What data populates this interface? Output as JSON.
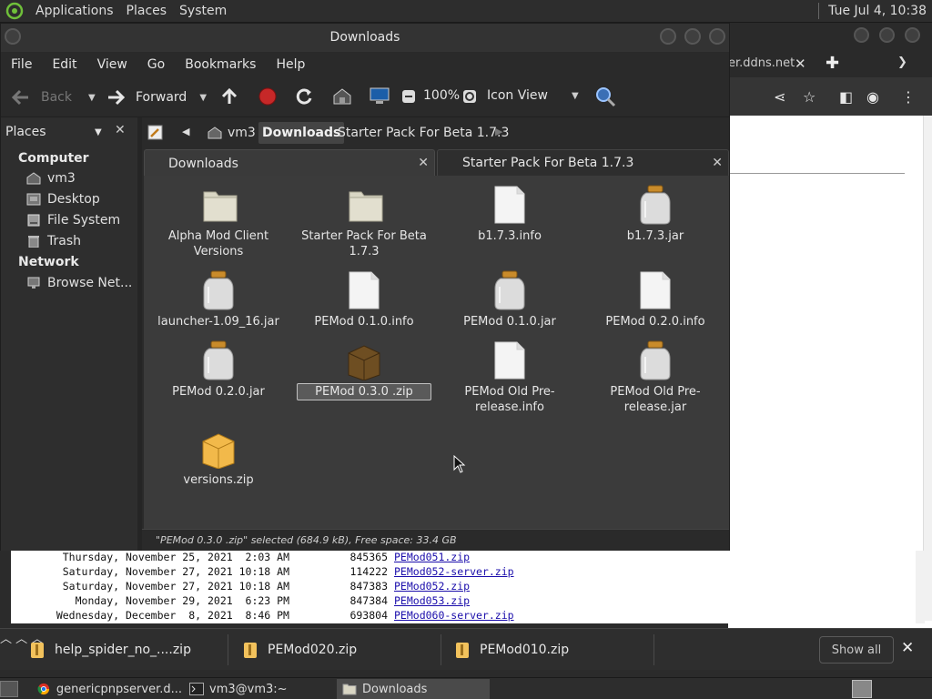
{
  "top_panel": {
    "menus": [
      "Applications",
      "Places",
      "System"
    ],
    "clock": "Tue Jul  4, 10:38"
  },
  "browser": {
    "tab_fragment": "er.ddns.net",
    "listing": [
      {
        "date": "Thursday, November 25, 2021  2:03 AM",
        "size": "845365",
        "name": "PEMod051.zip"
      },
      {
        "date": "Saturday, November 27, 2021 10:18 AM",
        "size": "114222",
        "name": "PEMod052-server.zip"
      },
      {
        "date": "Saturday, November 27, 2021 10:18 AM",
        "size": "847383",
        "name": "PEMod052.zip"
      },
      {
        "date": "Monday, November 29, 2021  6:23 PM",
        "size": "847384",
        "name": "PEMod053.zip"
      },
      {
        "date": "Wednesday, December  8, 2021  8:46 PM",
        "size": "693804",
        "name": "PEMod060-server.zip"
      }
    ],
    "downloads": [
      "help_spider_no_....zip",
      "PEMod020.zip",
      "PEMod010.zip"
    ],
    "show_all": "Show all"
  },
  "window": {
    "title": "Downloads",
    "menu": [
      "File",
      "Edit",
      "View",
      "Go",
      "Bookmarks",
      "Help"
    ],
    "toolbar": {
      "back": "Back",
      "forward": "Forward",
      "zoom": "100%",
      "view_mode": "Icon View"
    },
    "sidebar": {
      "header": "Places",
      "sections": [
        {
          "title": "Computer",
          "items": [
            "vm3",
            "Desktop",
            "File System",
            "Trash"
          ]
        },
        {
          "title": "Network",
          "items": [
            "Browse Net..."
          ]
        }
      ]
    },
    "breadcrumbs": [
      "vm3",
      "Downloads",
      "Starter Pack For Beta 1.7.3"
    ],
    "tabs": [
      "Downloads",
      "Starter Pack For Beta 1.7.3"
    ],
    "files": [
      {
        "name": "Alpha Mod Client Versions",
        "type": "folder"
      },
      {
        "name": "Starter Pack For Beta 1.7.3",
        "type": "folder"
      },
      {
        "name": "b1.7.3.info",
        "type": "document"
      },
      {
        "name": "b1.7.3.jar",
        "type": "jar"
      },
      {
        "name": "launcher-1.09_16.jar",
        "type": "jar"
      },
      {
        "name": "PEMod 0.1.0.info",
        "type": "document"
      },
      {
        "name": "PEMod 0.1.0.jar",
        "type": "jar"
      },
      {
        "name": "PEMod 0.2.0.info",
        "type": "document"
      },
      {
        "name": "PEMod 0.2.0.jar",
        "type": "jar"
      },
      {
        "name": "PEMod 0.3.0 .zip",
        "type": "archive-selected"
      },
      {
        "name": "PEMod Old Pre-release.info",
        "type": "document"
      },
      {
        "name": "PEMod Old Pre-release.jar",
        "type": "jar"
      },
      {
        "name": "versions.zip",
        "type": "archive"
      }
    ],
    "status": "\"PEMod 0.3.0 .zip\" selected (684.9 kB), Free space: 33.4 GB"
  },
  "taskbar": {
    "tasks": [
      "genericpnpserver.d...",
      "vm3@vm3:~",
      "Downloads"
    ]
  },
  "colors": {
    "folder": "#d9d6c4",
    "jar_lid": "#c98b2a",
    "link": "#1a0dab",
    "archive": "#f2b94a"
  }
}
